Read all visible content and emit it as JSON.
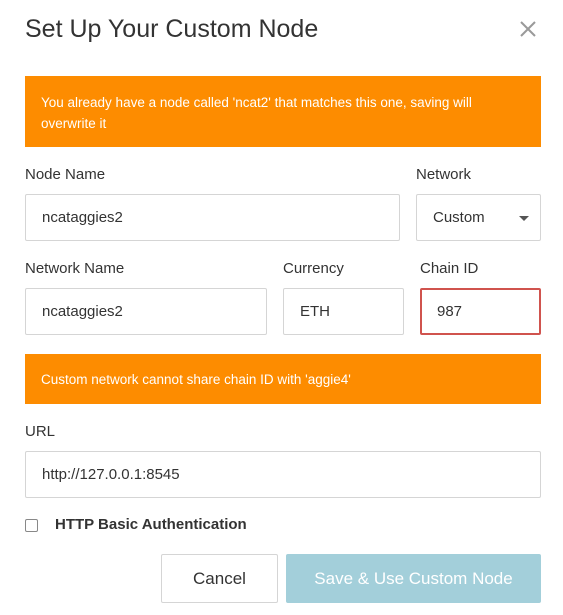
{
  "dialog": {
    "title": "Set Up Your Custom Node",
    "close_icon": "close-icon"
  },
  "warnings": {
    "duplicate_node": "You already have a node called 'ncat2' that matches this one, saving will overwrite it",
    "chain_id_conflict": "Custom network cannot share chain ID with 'aggie4'"
  },
  "form": {
    "node_name": {
      "label": "Node Name",
      "value": "ncataggies2"
    },
    "network": {
      "label": "Network",
      "selected": "Custom",
      "icon": "chevron-down-icon"
    },
    "network_name": {
      "label": "Network Name",
      "value": "ncataggies2"
    },
    "currency": {
      "label": "Currency",
      "value": "ETH"
    },
    "chain_id": {
      "label": "Chain ID",
      "value": "987",
      "state": "error",
      "error_color": "#d0534e"
    },
    "url": {
      "label": "URL",
      "value": "http://127.0.0.1:8545"
    },
    "http_auth": {
      "label": "HTTP Basic Authentication",
      "checked": false
    }
  },
  "buttons": {
    "cancel": "Cancel",
    "save": "Save & Use Custom Node",
    "save_disabled": true
  },
  "colors": {
    "warning_bg": "#fd8c00",
    "primary_disabled": "#a3cfda",
    "border": "#d5d5d5",
    "text": "#333333"
  }
}
